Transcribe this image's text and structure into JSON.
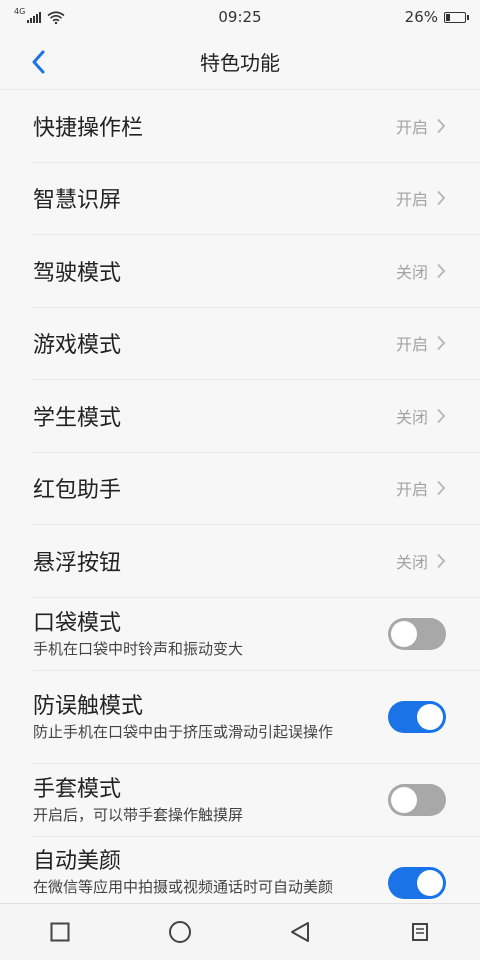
{
  "status_bar": {
    "network": "4G",
    "time": "09:25",
    "battery_text": "26%",
    "battery_level": 26
  },
  "header": {
    "title": "特色功能",
    "back_icon": "chevron-left-icon",
    "accent_color": "#1a74e8"
  },
  "nav_items": [
    {
      "label": "快捷操作栏",
      "status": "开启"
    },
    {
      "label": "智慧识屏",
      "status": "开启"
    },
    {
      "label": "驾驶模式",
      "status": "关闭"
    },
    {
      "label": "游戏模式",
      "status": "开启"
    },
    {
      "label": "学生模式",
      "status": "关闭"
    },
    {
      "label": "红包助手",
      "status": "开启"
    },
    {
      "label": "悬浮按钮",
      "status": "关闭"
    }
  ],
  "toggle_items": [
    {
      "title": "口袋模式",
      "desc": "手机在口袋中时铃声和振动变大",
      "on": false
    },
    {
      "title": "防误触模式",
      "desc": "防止手机在口袋中由于挤压或滑动引起误操作",
      "on": true
    },
    {
      "title": "手套模式",
      "desc": "开启后，可以带手套操作触摸屏",
      "on": false
    },
    {
      "title": "自动美颜",
      "desc": "在微信等应用中拍摄或视频通话时可自动美颜",
      "on": true
    }
  ],
  "bottom_nav": {
    "icons": [
      "square-icon",
      "circle-icon",
      "triangle-back-icon",
      "menu-icon"
    ]
  }
}
